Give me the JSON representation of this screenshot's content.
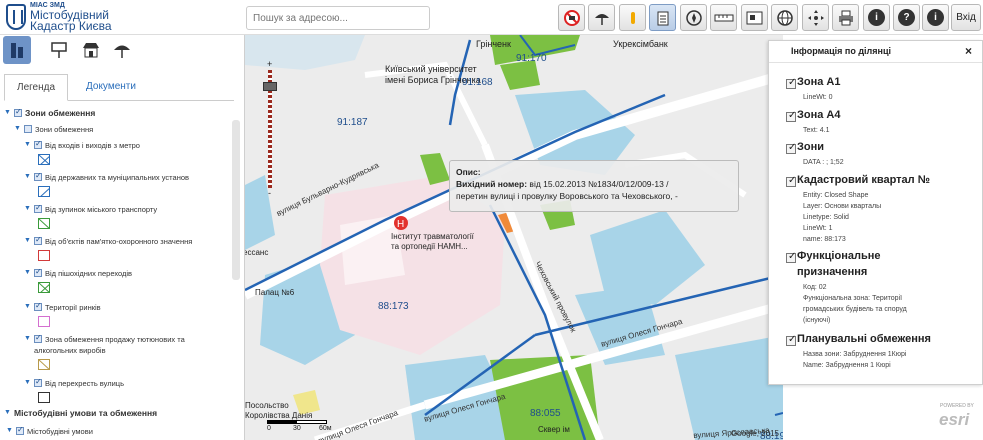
{
  "header": {
    "logo_small": "МІАС ЗМД",
    "logo_title_line1": "Містобудівний",
    "logo_title_line2": "Кадастр Києва",
    "search_placeholder": "Пошук за адресою...",
    "login_label": "Вхід",
    "tools": [
      {
        "icon": "no-entry-icon"
      },
      {
        "icon": "umbrella-icon"
      },
      {
        "icon": "pin-icon"
      },
      {
        "icon": "clipboard-icon"
      },
      {
        "icon": "compass-icon"
      },
      {
        "icon": "ruler-icon"
      },
      {
        "icon": "area-measure-icon"
      },
      {
        "icon": "globe-icon"
      },
      {
        "icon": "move-icon"
      },
      {
        "icon": "print-icon"
      },
      {
        "icon": "info-icon",
        "glyph": "i"
      },
      {
        "icon": "help-icon",
        "glyph": "?"
      },
      {
        "icon": "about-icon",
        "glyph": "i"
      }
    ]
  },
  "left_panel": {
    "tabs": [
      "Легенда",
      "Документи"
    ],
    "tree": [
      {
        "label": "Зони обмеження",
        "level": 0,
        "bold": true
      },
      {
        "label": "Зони обмеження",
        "level": 1
      },
      {
        "label": "Від входів і виходів з метро",
        "level": 2
      },
      {
        "label": "Від державних та муніципальних установ",
        "level": 2
      },
      {
        "label": "Від зупинок міського транспорту",
        "level": 2
      },
      {
        "label": "Від об'єктів пам'ятко-охоронного значення",
        "level": 2
      },
      {
        "label": "Від пішохідних переходів",
        "level": 2
      },
      {
        "label": "Території ринків",
        "level": 2
      },
      {
        "label": "Зона обмеження продажу тютюнових та",
        "label2": "алкогольних виробів",
        "level": 2
      },
      {
        "label": "Від перехресть вулиць",
        "level": 2
      },
      {
        "label": "Містобудівні умови та обмеження",
        "level": 0,
        "bold": true
      },
      {
        "label": "Містобудівні умови",
        "level": 1
      }
    ]
  },
  "map": {
    "labels": {
      "grinchenko_top": "Грінченк",
      "univ1": "Київський університет",
      "univ2": "імені Бориса Грінченка",
      "ukr": "Укрексімбанк",
      "q91170": "91:170",
      "q91168": "91:168",
      "q91187": "91:187",
      "q88173": "88:173",
      "q88055": "88:055",
      "q88199": "88:199",
      "inst1": "Інститут травматології",
      "inst2": "та ортопедії НАМН...",
      "palats": "Палац №6",
      "embassy1": "Посольство",
      "embassy2": "Королівства Данія",
      "skver": "Сквер ім",
      "essans": "ессанс",
      "street_kudryavska": "вулиця Бульварно-Кудрявська",
      "street_chekhov": "Чеховський провулок",
      "street_gonchara1": "вулиця Олеся Гончара",
      "street_gonchara2": "вулиця Олеся Гончара",
      "street_gonchara3": "вулиця Олеся Гончара",
      "street_yarosl": "вулиця Ярославська"
    },
    "popup": {
      "title": "Опис:",
      "key": "Вихідний номер:",
      "value": "від 15.02.2013 №1834/0/12/009-13 /",
      "value2": "перетин вулиці і провулку Воровського та Чеховського, -"
    },
    "scale": {
      "s0": "0",
      "s1": "30",
      "s2": "60м"
    },
    "attribution": "Google, 2015",
    "esri": "esri",
    "powered": "POWERED BY",
    "zoom_plus": "+",
    "zoom_minus": "-"
  },
  "right_panel": {
    "title": "Інформація по ділянці",
    "close": "×",
    "items": [
      {
        "name": "Зона А1",
        "attrs": [
          "LineWt: 0"
        ]
      },
      {
        "name": "Зона А4",
        "attrs": [
          "Text: 4.1"
        ]
      },
      {
        "name": "Зони",
        "attrs": [
          "DATA : ; 1;52"
        ]
      },
      {
        "name": "Кадастровий квартал №",
        "attrs": [
          "Entity: Closed Shape",
          "Layer: Основи кварталы",
          "Linetype: Solid",
          "LineWt: 1",
          "name: 88:173"
        ]
      },
      {
        "name": "Функціональне",
        "name2": "призначення",
        "attrs": [
          "Код: 02",
          "Функціональна зона: Території",
          "громадських будівель та споруд",
          "(існуючі)"
        ]
      },
      {
        "name": "Планувальні обмеження",
        "attrs": [
          "Назва зони: Забруднення 1Кюрі",
          "Name: Забруднення 1 Кюрі"
        ]
      }
    ]
  },
  "colors": {
    "brand": "#1f4e8c",
    "link": "#2a6ebb",
    "road_blue": "#2464b4",
    "green": "#7cc043",
    "water": "#a8d4e8",
    "pink": "#f5e1e6",
    "orange": "#f08a3a"
  }
}
